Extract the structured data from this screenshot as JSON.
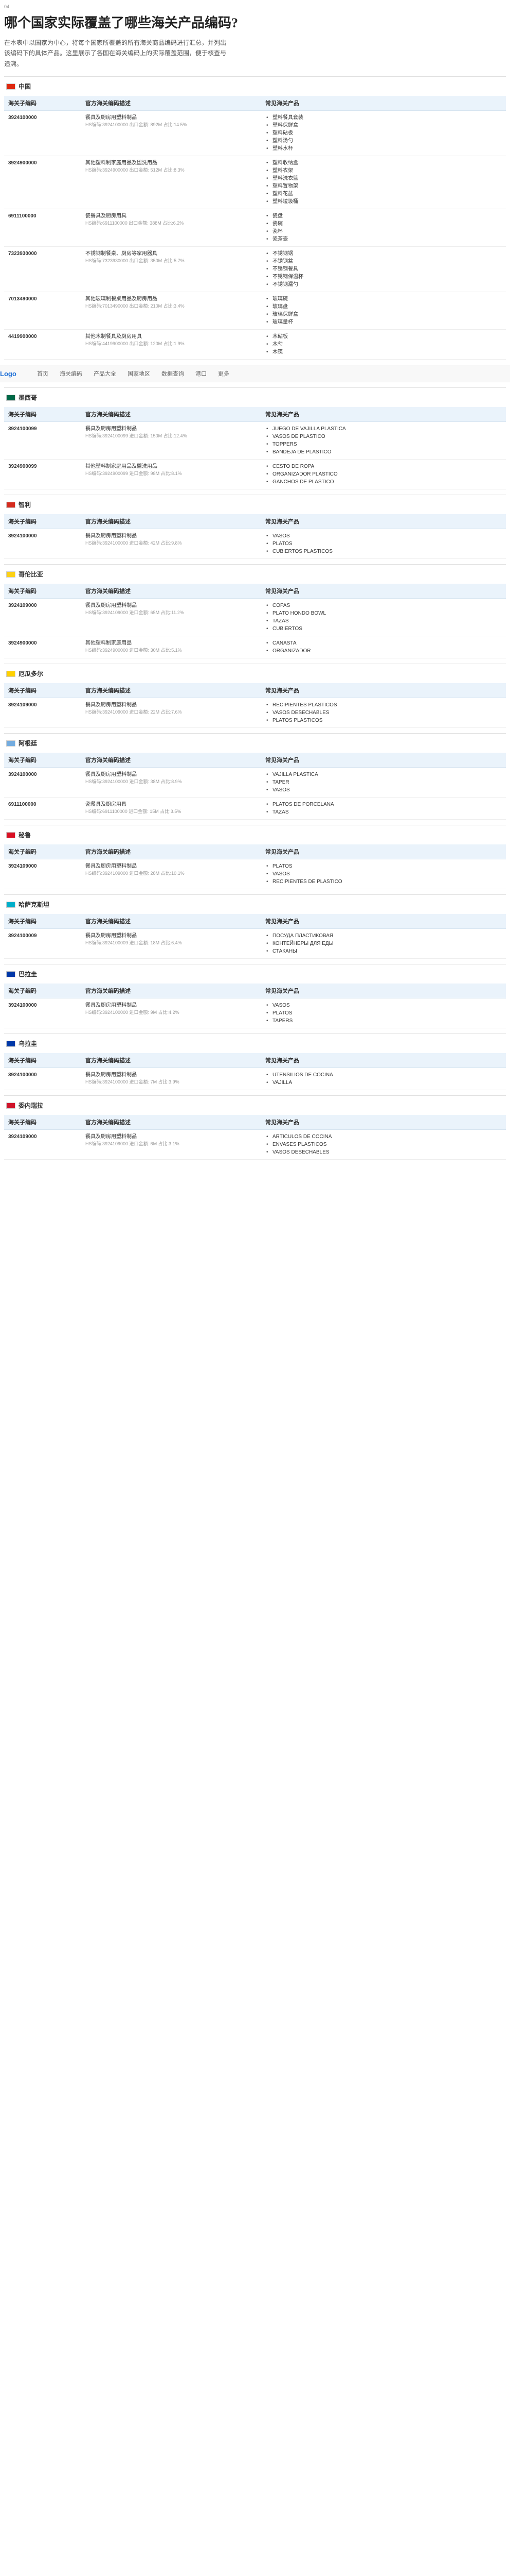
{
  "intro": {
    "tag": "04",
    "title": "哪个国家实际覆盖了哪些海关产品编码?",
    "paragraph": "在本表中以国家为中心，将每个国家所覆盖的所有海关商品编码进行汇总，并列出该编码下的具体产品。这里展示了各国在海关编码上的实际覆盖范围，便于核查与追溯。"
  },
  "columns": {
    "code": "海关子编码",
    "desc": "官方海关编码描述",
    "prods": "常见海关产品"
  },
  "nav": {
    "logo": "Logo",
    "items": [
      "首页",
      "海关编码",
      "产品大全",
      "国家地区",
      "数据查询",
      "港口",
      "更多"
    ]
  },
  "sections": [
    {
      "country": "中国",
      "flag": "#de2910",
      "rows": [
        {
          "code": "3924100000",
          "d1": "餐具及厨房用塑料制品",
          "d2": "HS编码:3924100000 出口金额: 892M 占比:14.5%",
          "prods": [
            "塑料餐具套装",
            "塑料保鲜盒",
            "塑料砧板",
            "塑料汤勺",
            "塑料水杯"
          ]
        },
        {
          "code": "3924900000",
          "d1": "其他塑料制家庭用品及盥洗用品",
          "d2": "HS编码:3924900000 出口金额: 512M 占比:8.3%",
          "prods": [
            "塑料收纳盒",
            "塑料衣架",
            "塑料洗衣篮",
            "塑料置物架",
            "塑料花盆",
            "塑料垃圾桶"
          ]
        },
        {
          "code": "6911100000",
          "d1": "瓷餐具及厨房用具",
          "d2": "HS编码:6911100000 出口金额: 388M 占比:6.2%",
          "prods": [
            "瓷盘",
            "瓷碗",
            "瓷杯",
            "瓷茶壶"
          ]
        },
        {
          "code": "7323930000",
          "d1": "不锈钢制餐桌、厨房等家用器具",
          "d2": "HS编码:7323930000 出口金额: 350M 占比:5.7%",
          "prods": [
            "不锈钢锅",
            "不锈钢盆",
            "不锈钢餐具",
            "不锈钢保温杯",
            "不锈钢漏勺"
          ]
        },
        {
          "code": "7013490000",
          "d1": "其他玻璃制餐桌用品及厨房用品",
          "d2": "HS编码:7013490000 出口金额: 210M 占比:3.4%",
          "prods": [
            "玻璃碗",
            "玻璃盘",
            "玻璃保鲜盒",
            "玻璃量杯"
          ]
        },
        {
          "code": "4419900000",
          "d1": "其他木制餐具及厨房用具",
          "d2": "HS编码:4419900000 出口金额: 120M 占比:1.9%",
          "prods": [
            "木砧板",
            "木勺",
            "木筷"
          ]
        }
      ]
    },
    {
      "country": "墨西哥",
      "flag": "#006847",
      "rows": [
        {
          "code": "3924100099",
          "d1": "餐具及厨房用塑料制品",
          "d2": "HS编码:3924100099 进口金额: 150M 占比:12.4%",
          "prods": [
            "JUEGO DE VAJILLA PLASTICA",
            "VASOS DE PLASTICO",
            "TOPPERS",
            "BANDEJA DE PLASTICO"
          ]
        },
        {
          "code": "3924900099",
          "d1": "其他塑料制家庭用品及盥洗用品",
          "d2": "HS编码:3924900099 进口金额: 98M 占比:8.1%",
          "prods": [
            "CESTO DE ROPA",
            "ORGANIZADOR PLASTICO",
            "GANCHOS DE PLASTICO"
          ]
        }
      ]
    },
    {
      "country": "智利",
      "flag": "#d52b1e",
      "rows": [
        {
          "code": "3924100000",
          "d1": "餐具及厨房用塑料制品",
          "d2": "HS编码:3924100000 进口金额: 42M 占比:9.8%",
          "prods": [
            "VASOS",
            "PLATOS",
            "CUBIERTOS PLASTICOS"
          ]
        }
      ]
    },
    {
      "country": "哥伦比亚",
      "flag": "#fcd116",
      "rows": [
        {
          "code": "3924109000",
          "d1": "餐具及厨房用塑料制品",
          "d2": "HS编码:3924109000 进口金额: 65M 占比:11.2%",
          "prods": [
            "COPAS",
            "PLATO HONDO BOWL",
            "TAZAS",
            "CUBIERTOS"
          ]
        },
        {
          "code": "3924900000",
          "d1": "其他塑料制家庭用品",
          "d2": "HS编码:3924900000 进口金额: 30M 占比:5.1%",
          "prods": [
            "CANASTA",
            "ORGANIZADOR"
          ]
        }
      ]
    },
    {
      "country": "厄瓜多尔",
      "flag": "#ffd100",
      "rows": [
        {
          "code": "3924109000",
          "d1": "餐具及厨房用塑料制品",
          "d2": "HS编码:3924109000 进口金额: 22M 占比:7.6%",
          "prods": [
            "RECIPIENTES PLASTICOS",
            "VASOS DESECHABLES",
            "PLATOS PLASTICOS"
          ]
        }
      ]
    },
    {
      "country": "阿根廷",
      "flag": "#74acdf",
      "rows": [
        {
          "code": "3924100000",
          "d1": "餐具及厨房用塑料制品",
          "d2": "HS编码:3924100000 进口金额: 38M 占比:8.9%",
          "prods": [
            "VAJILLA PLASTICA",
            "TAPER",
            "VASOS"
          ]
        },
        {
          "code": "6911100000",
          "d1": "瓷餐具及厨房用具",
          "d2": "HS编码:6911100000 进口金额: 15M 占比:3.5%",
          "prods": [
            "PLATOS DE PORCELANA",
            "TAZAS"
          ]
        }
      ]
    },
    {
      "country": "秘鲁",
      "flag": "#d91023",
      "rows": [
        {
          "code": "3924109000",
          "d1": "餐具及厨房用塑料制品",
          "d2": "HS编码:3924109000 进口金额: 28M 占比:10.1%",
          "prods": [
            "PLATOS",
            "VASOS",
            "RECIPIENTES DE PLASTICO"
          ]
        }
      ]
    },
    {
      "country": "哈萨克斯坦",
      "flag": "#00afca",
      "rows": [
        {
          "code": "3924100009",
          "d1": "餐具及厨房用塑料制品",
          "d2": "HS编码:3924100009 进口金额: 18M 占比:6.4%",
          "prods": [
            "ПОСУДА ПЛАСТИКОВАЯ",
            "КОНТЕЙНЕРЫ ДЛЯ ЕДЫ",
            "СТАКАНЫ"
          ]
        }
      ]
    },
    {
      "country": "巴拉圭",
      "flag": "#0038a8",
      "rows": [
        {
          "code": "3924100000",
          "d1": "餐具及厨房用塑料制品",
          "d2": "HS编码:3924100000 进口金额: 9M 占比:4.2%",
          "prods": [
            "VASOS",
            "PLATOS",
            "TAPERS"
          ]
        }
      ]
    },
    {
      "country": "乌拉圭",
      "flag": "#0038a8",
      "rows": [
        {
          "code": "3924100000",
          "d1": "餐具及厨房用塑料制品",
          "d2": "HS编码:3924100000 进口金额: 7M 占比:3.9%",
          "prods": [
            "UTENSILIOS DE COCINA",
            "VAJILLA"
          ]
        }
      ]
    },
    {
      "country": "委内瑞拉",
      "flag": "#cf142b",
      "rows": [
        {
          "code": "3924109000",
          "d1": "餐具及厨房用塑料制品",
          "d2": "HS编码:3924109000 进口金额: 6M 占比:3.1%",
          "prods": [
            "ARTICULOS DE COCINA",
            "ENVASES PLASTICOS",
            "VASOS DESECHABLES"
          ]
        }
      ]
    }
  ]
}
